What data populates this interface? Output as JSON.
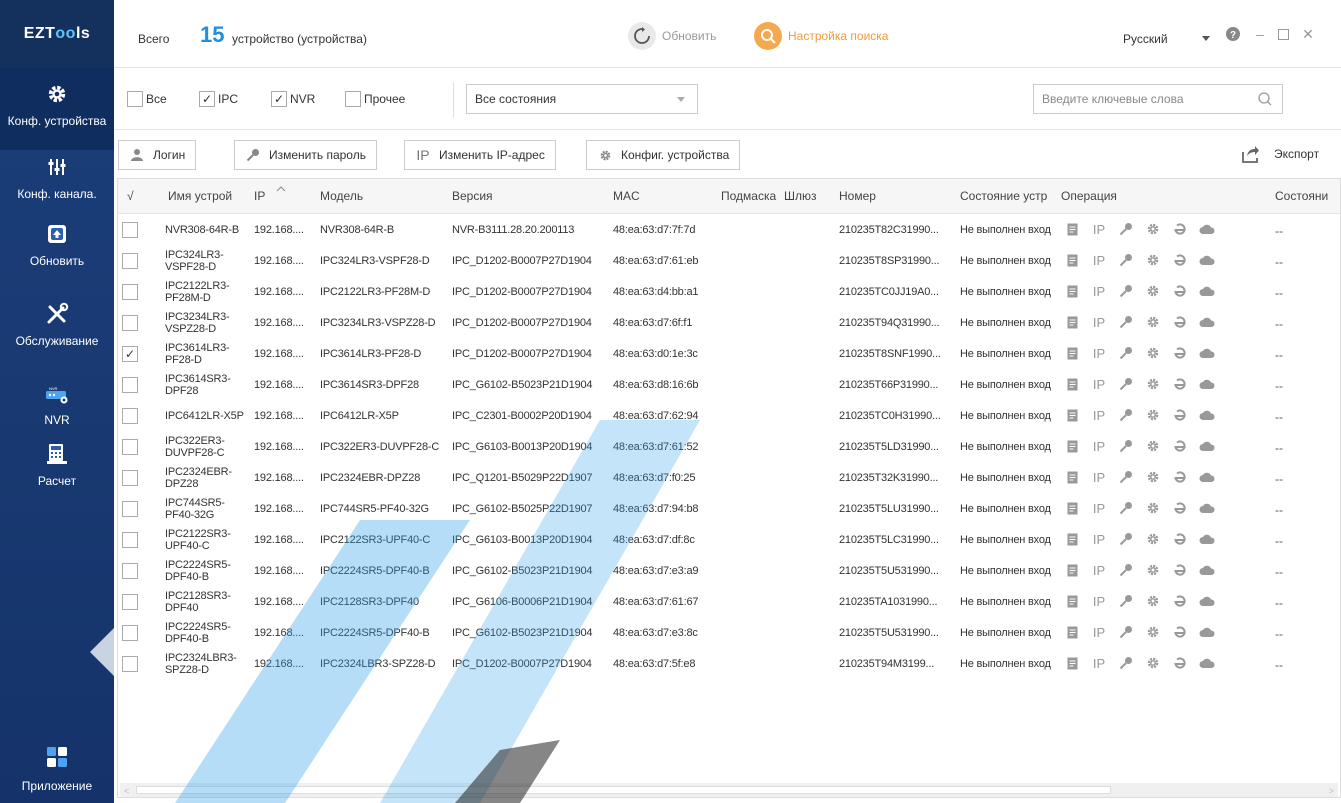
{
  "app": {
    "logo_pre": "EZT",
    "logo_o": "oo",
    "logo_post": "ls"
  },
  "sidebar": {
    "items": [
      {
        "label": "Конф. устройства",
        "icon": "gear-icon",
        "active": true
      },
      {
        "label": "Конф. канала.",
        "icon": "sliders-icon"
      },
      {
        "label": "Обновить",
        "icon": "upgrade-icon"
      },
      {
        "label": "Обслуживание",
        "icon": "tools-icon"
      },
      {
        "label": "NVR",
        "icon": "nvr-icon"
      },
      {
        "label": "Расчет",
        "icon": "calculator-icon"
      },
      {
        "label": "Приложение",
        "icon": "apps-icon"
      }
    ]
  },
  "header": {
    "total_label": "Всего",
    "total_count": "15",
    "devices_label": "устройство (устройства)",
    "refresh_label": "Обновить",
    "search_settings_label": "Настройка поиска",
    "language": "Русский"
  },
  "filter": {
    "all_label": "Все",
    "ipc_label": "IPC",
    "nvr_label": "NVR",
    "other_label": "Прочее",
    "state_select": "Все состояния",
    "keyword_placeholder": "Введите ключевые слова"
  },
  "toolbar": {
    "login": "Логин",
    "change_password": "Изменить пароль",
    "change_ip": "Изменить IP-адрес",
    "device_config": "Конфиг. устройства",
    "export": "Экспорт"
  },
  "table": {
    "headers": {
      "check": "√",
      "name": "Имя устрой",
      "ip": "IP",
      "model": "Модель",
      "version": "Версия",
      "mac": "MAC",
      "mask": "Подмаска",
      "gateway": "Шлюз",
      "number": "Номер",
      "dev_state": "Состояние устр",
      "operation": "Операция",
      "state": "Состояни"
    },
    "rows": [
      {
        "name": "NVR308-64R-B",
        "ip": "192.168....",
        "model": "NVR308-64R-B",
        "version": "NVR-B3111.28.20.200113",
        "mac": "48:ea:63:d7:7f:7d",
        "number": "210235T82C31990...",
        "state": "Не выполнен вход",
        "checked": false,
        "last": "--"
      },
      {
        "name": "IPC324LR3-VSPF28-D",
        "ip": "192.168....",
        "model": "IPC324LR3-VSPF28-D",
        "version": "IPC_D1202-B0007P27D1904",
        "mac": "48:ea:63:d7:61:eb",
        "number": "210235T8SP31990...",
        "state": "Не выполнен вход",
        "checked": false,
        "last": "--"
      },
      {
        "name": "IPC2122LR3-PF28M-D",
        "ip": "192.168....",
        "model": "IPC2122LR3-PF28M-D",
        "version": "IPC_D1202-B0007P27D1904",
        "mac": "48:ea:63:d4:bb:a1",
        "number": "210235TC0JJ19A0...",
        "state": "Не выполнен вход",
        "checked": false,
        "last": "--"
      },
      {
        "name": "IPC3234LR3-VSPZ28-D",
        "ip": "192.168....",
        "model": "IPC3234LR3-VSPZ28-D",
        "version": "IPC_D1202-B0007P27D1904",
        "mac": "48:ea:63:d7:6f:f1",
        "number": "210235T94Q31990...",
        "state": "Не выполнен вход",
        "checked": false,
        "last": "--"
      },
      {
        "name": "IPC3614LR3-PF28-D",
        "ip": "192.168....",
        "model": "IPC3614LR3-PF28-D",
        "version": "IPC_D1202-B0007P27D1904",
        "mac": "48:ea:63:d0:1e:3c",
        "number": "210235T8SNF1990...",
        "state": "Не выполнен вход",
        "checked": true,
        "last": "--"
      },
      {
        "name": "IPC3614SR3-DPF28",
        "ip": "192.168....",
        "model": "IPC3614SR3-DPF28",
        "version": "IPC_G6102-B5023P21D1904",
        "mac": "48:ea:63:d8:16:6b",
        "number": "210235T66P31990...",
        "state": "Не выполнен вход",
        "checked": false,
        "last": "--"
      },
      {
        "name": "IPC6412LR-X5P",
        "ip": "192.168....",
        "model": "IPC6412LR-X5P",
        "version": "IPC_C2301-B0002P20D1904",
        "mac": "48:ea:63:d7:62:94",
        "number": "210235TC0H31990...",
        "state": "Не выполнен вход",
        "checked": false,
        "last": "--"
      },
      {
        "name": "IPC322ER3-DUVPF28-C",
        "ip": "192.168....",
        "model": "IPC322ER3-DUVPF28-C",
        "version": "IPC_G6103-B0013P20D1904",
        "mac": "48:ea:63:d7:61:52",
        "number": "210235T5LD31990...",
        "state": "Не выполнен вход",
        "checked": false,
        "last": "--"
      },
      {
        "name": "IPC2324EBR-DPZ28",
        "ip": "192.168....",
        "model": "IPC2324EBR-DPZ28",
        "version": "IPC_Q1201-B5029P22D1907",
        "mac": "48:ea:63:d7:f0:25",
        "number": "210235T32K31990...",
        "state": "Не выполнен вход",
        "checked": false,
        "last": "--"
      },
      {
        "name": "IPC744SR5-PF40-32G",
        "ip": "192.168....",
        "model": "IPC744SR5-PF40-32G",
        "version": "IPC_G6102-B5025P22D1907",
        "mac": "48:ea:63:d7:94:b8",
        "number": "210235T5LU31990...",
        "state": "Не выполнен вход",
        "checked": false,
        "last": "--"
      },
      {
        "name": "IPC2122SR3-UPF40-C",
        "ip": "192.168....",
        "model": "IPC2122SR3-UPF40-C",
        "version": "IPC_G6103-B0013P20D1904",
        "mac": "48:ea:63:d7:df:8c",
        "number": "210235T5LC31990...",
        "state": "Не выполнен вход",
        "checked": false,
        "last": "--"
      },
      {
        "name": "IPC2224SR5-DPF40-B",
        "ip": "192.168....",
        "model": "IPC2224SR5-DPF40-B",
        "version": "IPC_G6102-B5023P21D1904",
        "mac": "48:ea:63:d7:e3:a9",
        "number": "210235T5U531990...",
        "state": "Не выполнен вход",
        "checked": false,
        "last": "--"
      },
      {
        "name": "IPC2128SR3-DPF40",
        "ip": "192.168....",
        "model": "IPC2128SR3-DPF40",
        "version": "IPC_G6106-B0006P21D1904",
        "mac": "48:ea:63:d7:61:67",
        "number": "210235TA1031990...",
        "state": "Не выполнен вход",
        "checked": false,
        "last": "--"
      },
      {
        "name": "IPC2224SR5-DPF40-B",
        "ip": "192.168....",
        "model": "IPC2224SR5-DPF40-B",
        "version": "IPC_G6102-B5023P21D1904",
        "mac": "48:ea:63:d7:e3:8c",
        "number": "210235T5U531990...",
        "state": "Не выполнен вход",
        "checked": false,
        "last": "--"
      },
      {
        "name": "IPC2324LBR3-SPZ28-D",
        "ip": "192.168....",
        "model": "IPC2324LBR3-SPZ28-D",
        "version": "IPC_D1202-B0007P27D1904",
        "mac": "48:ea:63:d7:5f:e8",
        "number": "210235T94M3199...",
        "state": "Не выполнен вход",
        "checked": false,
        "last": "--"
      }
    ]
  },
  "colors": {
    "sidebar": "#1c3f7a",
    "accent": "#1e8fe1",
    "orange": "#f5a84f"
  }
}
